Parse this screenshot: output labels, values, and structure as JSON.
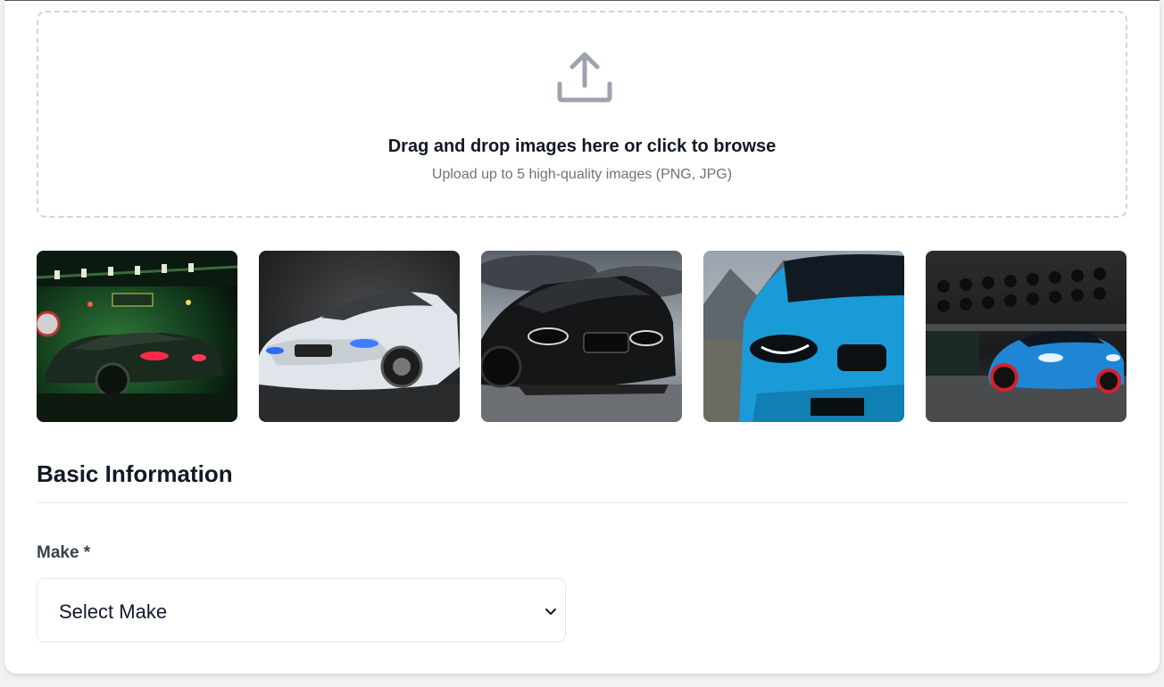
{
  "upload": {
    "icon": "upload-icon",
    "title": "Drag and drop images here or click to browse",
    "subtitle": "Upload up to 5 high-quality images (PNG, JPG)"
  },
  "gallery": {
    "images": [
      {
        "name": "car-photo-green-garage"
      },
      {
        "name": "car-photo-white-studio"
      },
      {
        "name": "car-photo-black-cloudy"
      },
      {
        "name": "car-photo-blue-mountains"
      },
      {
        "name": "car-photo-blue-warehouse"
      }
    ]
  },
  "basic_info": {
    "title": "Basic Information",
    "make_label": "Make *",
    "make_value": "Select Make",
    "chevron_icon": "chevron-down-icon"
  },
  "colors": {
    "border_dashed": "#d1d5db",
    "text_primary": "#111827",
    "text_muted": "#6b7280",
    "label": "#374151",
    "divider": "#e5e7eb"
  }
}
